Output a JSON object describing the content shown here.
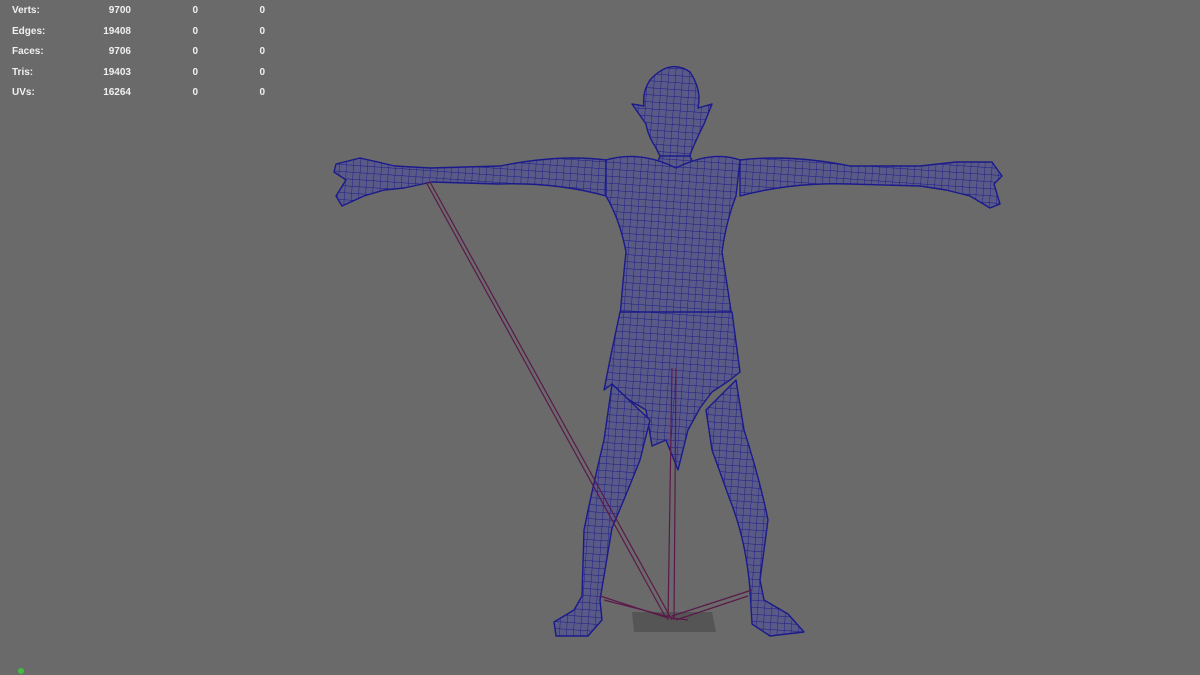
{
  "hud": {
    "rows": [
      {
        "label": "Verts:",
        "v1": "9700",
        "v2": "0",
        "v3": "0"
      },
      {
        "label": "Edges:",
        "v1": "19408",
        "v2": "0",
        "v3": "0"
      },
      {
        "label": "Faces:",
        "v1": "9706",
        "v2": "0",
        "v3": "0"
      },
      {
        "label": "Tris:",
        "v1": "19403",
        "v2": "0",
        "v3": "0"
      },
      {
        "label": "UVs:",
        "v1": "16264",
        "v2": "0",
        "v3": "0"
      }
    ]
  },
  "colors": {
    "background": "#6a6a6a",
    "mesh_fill": "#5a5a86",
    "mesh_wire": "#1a1a8c",
    "rig_lines": "#5a1a4a",
    "ground_shadow": "#555555"
  },
  "icons": {
    "axis_indicator": "axis-dot-icon"
  }
}
